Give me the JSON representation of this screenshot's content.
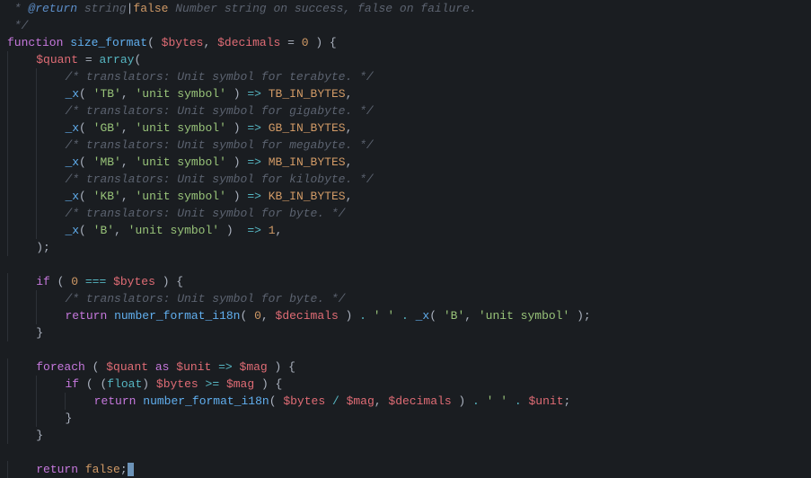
{
  "code": {
    "lines": [
      {
        "indent": 0,
        "tokens": [
          {
            "t": " * ",
            "c": "comment"
          },
          {
            "t": "@return",
            "c": "doctag"
          },
          {
            "t": " string",
            "c": "comment"
          },
          {
            "t": "|",
            "c": "punct"
          },
          {
            "t": "false",
            "c": "const"
          },
          {
            "t": " Number string on success, false on failure.",
            "c": "comment"
          }
        ]
      },
      {
        "indent": 0,
        "tokens": [
          {
            "t": " */",
            "c": "comment"
          }
        ]
      },
      {
        "indent": 0,
        "tokens": [
          {
            "t": "function",
            "c": "keyword"
          },
          {
            "t": " ",
            "c": "plain"
          },
          {
            "t": "size_format",
            "c": "func"
          },
          {
            "t": "( ",
            "c": "punct"
          },
          {
            "t": "$bytes",
            "c": "var"
          },
          {
            "t": ", ",
            "c": "punct"
          },
          {
            "t": "$decimals",
            "c": "var"
          },
          {
            "t": " = ",
            "c": "punct"
          },
          {
            "t": "0",
            "c": "number"
          },
          {
            "t": " ) {",
            "c": "punct"
          }
        ]
      },
      {
        "indent": 1,
        "tokens": [
          {
            "t": "$quant",
            "c": "var"
          },
          {
            "t": " = ",
            "c": "punct"
          },
          {
            "t": "array",
            "c": "builtin"
          },
          {
            "t": "(",
            "c": "punct"
          }
        ]
      },
      {
        "indent": 2,
        "tokens": [
          {
            "t": "/* translators: Unit symbol for terabyte. */",
            "c": "comment"
          }
        ]
      },
      {
        "indent": 2,
        "tokens": [
          {
            "t": "_x",
            "c": "func"
          },
          {
            "t": "( ",
            "c": "punct"
          },
          {
            "t": "'TB'",
            "c": "string"
          },
          {
            "t": ", ",
            "c": "punct"
          },
          {
            "t": "'unit symbol'",
            "c": "string"
          },
          {
            "t": " ) ",
            "c": "punct"
          },
          {
            "t": "=>",
            "c": "op"
          },
          {
            "t": " ",
            "c": "plain"
          },
          {
            "t": "TB_IN_BYTES",
            "c": "const"
          },
          {
            "t": ",",
            "c": "punct"
          }
        ]
      },
      {
        "indent": 2,
        "tokens": [
          {
            "t": "/* translators: Unit symbol for gigabyte. */",
            "c": "comment"
          }
        ]
      },
      {
        "indent": 2,
        "tokens": [
          {
            "t": "_x",
            "c": "func"
          },
          {
            "t": "( ",
            "c": "punct"
          },
          {
            "t": "'GB'",
            "c": "string"
          },
          {
            "t": ", ",
            "c": "punct"
          },
          {
            "t": "'unit symbol'",
            "c": "string"
          },
          {
            "t": " ) ",
            "c": "punct"
          },
          {
            "t": "=>",
            "c": "op"
          },
          {
            "t": " ",
            "c": "plain"
          },
          {
            "t": "GB_IN_BYTES",
            "c": "const"
          },
          {
            "t": ",",
            "c": "punct"
          }
        ]
      },
      {
        "indent": 2,
        "tokens": [
          {
            "t": "/* translators: Unit symbol for megabyte. */",
            "c": "comment"
          }
        ]
      },
      {
        "indent": 2,
        "tokens": [
          {
            "t": "_x",
            "c": "func"
          },
          {
            "t": "( ",
            "c": "punct"
          },
          {
            "t": "'MB'",
            "c": "string"
          },
          {
            "t": ", ",
            "c": "punct"
          },
          {
            "t": "'unit symbol'",
            "c": "string"
          },
          {
            "t": " ) ",
            "c": "punct"
          },
          {
            "t": "=>",
            "c": "op"
          },
          {
            "t": " ",
            "c": "plain"
          },
          {
            "t": "MB_IN_BYTES",
            "c": "const"
          },
          {
            "t": ",",
            "c": "punct"
          }
        ]
      },
      {
        "indent": 2,
        "tokens": [
          {
            "t": "/* translators: Unit symbol for kilobyte. */",
            "c": "comment"
          }
        ]
      },
      {
        "indent": 2,
        "tokens": [
          {
            "t": "_x",
            "c": "func"
          },
          {
            "t": "( ",
            "c": "punct"
          },
          {
            "t": "'KB'",
            "c": "string"
          },
          {
            "t": ", ",
            "c": "punct"
          },
          {
            "t": "'unit symbol'",
            "c": "string"
          },
          {
            "t": " ) ",
            "c": "punct"
          },
          {
            "t": "=>",
            "c": "op"
          },
          {
            "t": " ",
            "c": "plain"
          },
          {
            "t": "KB_IN_BYTES",
            "c": "const"
          },
          {
            "t": ",",
            "c": "punct"
          }
        ]
      },
      {
        "indent": 2,
        "tokens": [
          {
            "t": "/* translators: Unit symbol for byte. */",
            "c": "comment"
          }
        ]
      },
      {
        "indent": 2,
        "tokens": [
          {
            "t": "_x",
            "c": "func"
          },
          {
            "t": "( ",
            "c": "punct"
          },
          {
            "t": "'B'",
            "c": "string"
          },
          {
            "t": ", ",
            "c": "punct"
          },
          {
            "t": "'unit symbol'",
            "c": "string"
          },
          {
            "t": " )  ",
            "c": "punct"
          },
          {
            "t": "=>",
            "c": "op"
          },
          {
            "t": " ",
            "c": "plain"
          },
          {
            "t": "1",
            "c": "number"
          },
          {
            "t": ",",
            "c": "punct"
          }
        ]
      },
      {
        "indent": 1,
        "tokens": [
          {
            "t": ");",
            "c": "punct"
          }
        ]
      },
      {
        "indent": 0,
        "tokens": []
      },
      {
        "indent": 1,
        "tokens": [
          {
            "t": "if",
            "c": "keyword"
          },
          {
            "t": " ( ",
            "c": "punct"
          },
          {
            "t": "0",
            "c": "number"
          },
          {
            "t": " ",
            "c": "plain"
          },
          {
            "t": "===",
            "c": "op"
          },
          {
            "t": " ",
            "c": "plain"
          },
          {
            "t": "$bytes",
            "c": "var"
          },
          {
            "t": " ) {",
            "c": "punct"
          }
        ]
      },
      {
        "indent": 2,
        "tokens": [
          {
            "t": "/* translators: Unit symbol for byte. */",
            "c": "comment"
          }
        ]
      },
      {
        "indent": 2,
        "tokens": [
          {
            "t": "return",
            "c": "keyword"
          },
          {
            "t": " ",
            "c": "plain"
          },
          {
            "t": "number_format_i18n",
            "c": "func"
          },
          {
            "t": "( ",
            "c": "punct"
          },
          {
            "t": "0",
            "c": "number"
          },
          {
            "t": ", ",
            "c": "punct"
          },
          {
            "t": "$decimals",
            "c": "var"
          },
          {
            "t": " ) ",
            "c": "punct"
          },
          {
            "t": ".",
            "c": "op"
          },
          {
            "t": " ",
            "c": "plain"
          },
          {
            "t": "' '",
            "c": "string"
          },
          {
            "t": " ",
            "c": "plain"
          },
          {
            "t": ".",
            "c": "op"
          },
          {
            "t": " ",
            "c": "plain"
          },
          {
            "t": "_x",
            "c": "func"
          },
          {
            "t": "( ",
            "c": "punct"
          },
          {
            "t": "'B'",
            "c": "string"
          },
          {
            "t": ", ",
            "c": "punct"
          },
          {
            "t": "'unit symbol'",
            "c": "string"
          },
          {
            "t": " );",
            "c": "punct"
          }
        ]
      },
      {
        "indent": 1,
        "tokens": [
          {
            "t": "}",
            "c": "punct"
          }
        ]
      },
      {
        "indent": 0,
        "tokens": []
      },
      {
        "indent": 1,
        "tokens": [
          {
            "t": "foreach",
            "c": "keyword"
          },
          {
            "t": " ( ",
            "c": "punct"
          },
          {
            "t": "$quant",
            "c": "var"
          },
          {
            "t": " ",
            "c": "plain"
          },
          {
            "t": "as",
            "c": "keyword"
          },
          {
            "t": " ",
            "c": "plain"
          },
          {
            "t": "$unit",
            "c": "var"
          },
          {
            "t": " ",
            "c": "plain"
          },
          {
            "t": "=>",
            "c": "op"
          },
          {
            "t": " ",
            "c": "plain"
          },
          {
            "t": "$mag",
            "c": "var"
          },
          {
            "t": " ) {",
            "c": "punct"
          }
        ]
      },
      {
        "indent": 2,
        "tokens": [
          {
            "t": "if",
            "c": "keyword"
          },
          {
            "t": " ( (",
            "c": "punct"
          },
          {
            "t": "float",
            "c": "builtin"
          },
          {
            "t": ") ",
            "c": "punct"
          },
          {
            "t": "$bytes",
            "c": "var"
          },
          {
            "t": " ",
            "c": "plain"
          },
          {
            "t": ">=",
            "c": "op"
          },
          {
            "t": " ",
            "c": "plain"
          },
          {
            "t": "$mag",
            "c": "var"
          },
          {
            "t": " ) {",
            "c": "punct"
          }
        ]
      },
      {
        "indent": 3,
        "tokens": [
          {
            "t": "return",
            "c": "keyword"
          },
          {
            "t": " ",
            "c": "plain"
          },
          {
            "t": "number_format_i18n",
            "c": "func"
          },
          {
            "t": "( ",
            "c": "punct"
          },
          {
            "t": "$bytes",
            "c": "var"
          },
          {
            "t": " ",
            "c": "plain"
          },
          {
            "t": "/",
            "c": "op"
          },
          {
            "t": " ",
            "c": "plain"
          },
          {
            "t": "$mag",
            "c": "var"
          },
          {
            "t": ", ",
            "c": "punct"
          },
          {
            "t": "$decimals",
            "c": "var"
          },
          {
            "t": " ) ",
            "c": "punct"
          },
          {
            "t": ".",
            "c": "op"
          },
          {
            "t": " ",
            "c": "plain"
          },
          {
            "t": "' '",
            "c": "string"
          },
          {
            "t": " ",
            "c": "plain"
          },
          {
            "t": ".",
            "c": "op"
          },
          {
            "t": " ",
            "c": "plain"
          },
          {
            "t": "$unit",
            "c": "var"
          },
          {
            "t": ";",
            "c": "punct"
          }
        ]
      },
      {
        "indent": 2,
        "tokens": [
          {
            "t": "}",
            "c": "punct"
          }
        ]
      },
      {
        "indent": 1,
        "tokens": [
          {
            "t": "}",
            "c": "punct"
          }
        ]
      },
      {
        "indent": 0,
        "tokens": []
      },
      {
        "indent": 1,
        "tokens": [
          {
            "t": "return",
            "c": "keyword"
          },
          {
            "t": " ",
            "c": "plain"
          },
          {
            "t": "false",
            "c": "const"
          },
          {
            "t": ";",
            "c": "punct"
          }
        ],
        "cursor": true
      }
    ]
  }
}
